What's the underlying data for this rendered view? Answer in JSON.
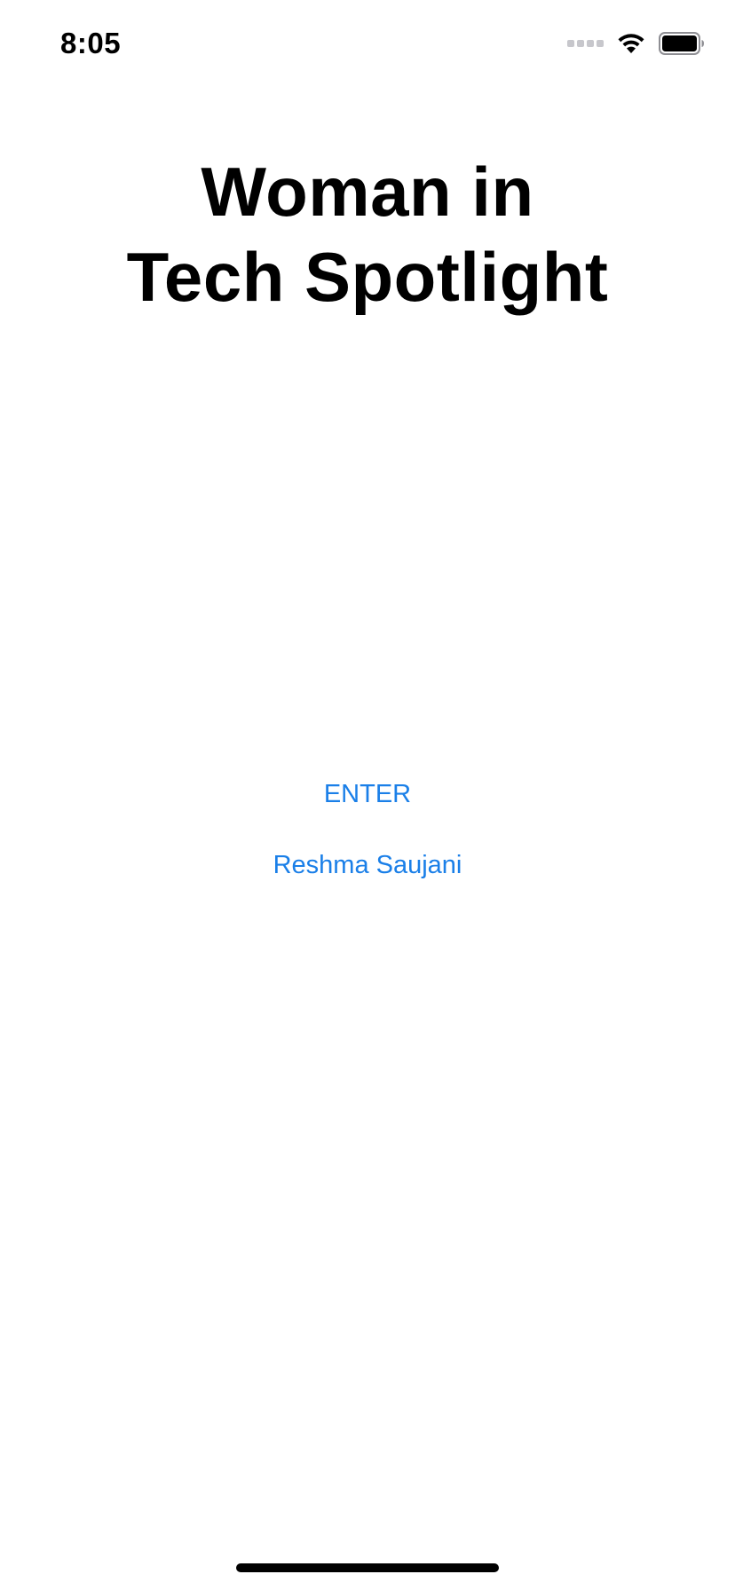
{
  "status_bar": {
    "time": "8:05",
    "icons": [
      "signal-icon",
      "wifi-icon",
      "battery-icon"
    ]
  },
  "title": {
    "line1": "Woman in",
    "line2": "Tech Spotlight"
  },
  "buttons": {
    "enter_label": "ENTER",
    "name_label": "Reshma Saujani"
  },
  "colors": {
    "accent": "#1a7fe8",
    "text": "#000000",
    "background": "#ffffff"
  }
}
